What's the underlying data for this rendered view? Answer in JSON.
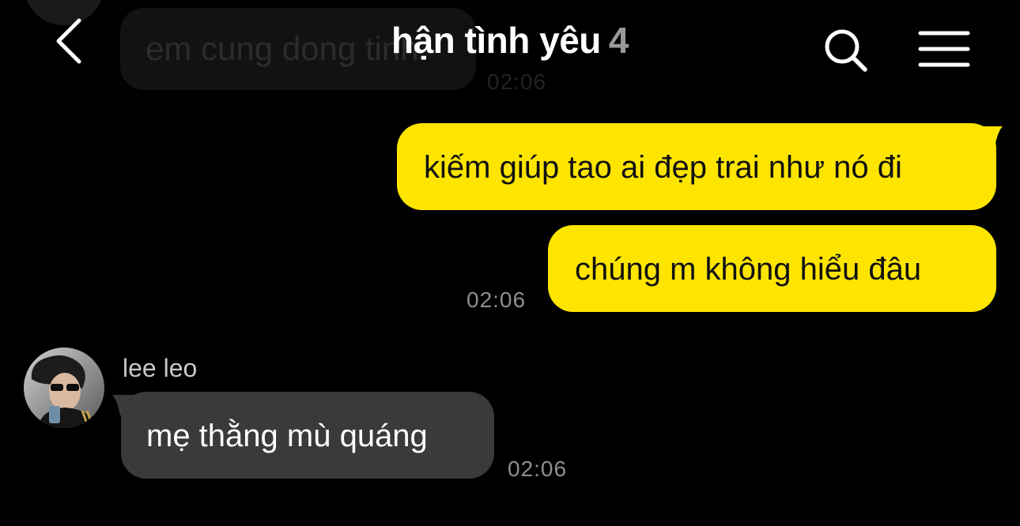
{
  "header": {
    "title": "hận tình yêu",
    "member_count": "4",
    "icons": [
      "back-icon",
      "search-icon",
      "menu-icon"
    ]
  },
  "previous_message": {
    "text": "em cung dong tinh",
    "time": "02:06"
  },
  "messages": [
    {
      "direction": "outgoing",
      "text": "kiếm giúp tao ai đẹp trai như nó đi"
    },
    {
      "direction": "outgoing",
      "text": "chúng m không hiểu đâu",
      "time": "02:06"
    },
    {
      "direction": "incoming",
      "sender": "lee leo",
      "text": "mẹ thằng mù quáng",
      "time": "02:06"
    }
  ],
  "colors": {
    "background": "#000000",
    "outgoing_bubble": "#fee500",
    "incoming_bubble": "#3a3a3c",
    "timestamp": "#8e8e8e",
    "member_count": "#9a9a9a"
  }
}
